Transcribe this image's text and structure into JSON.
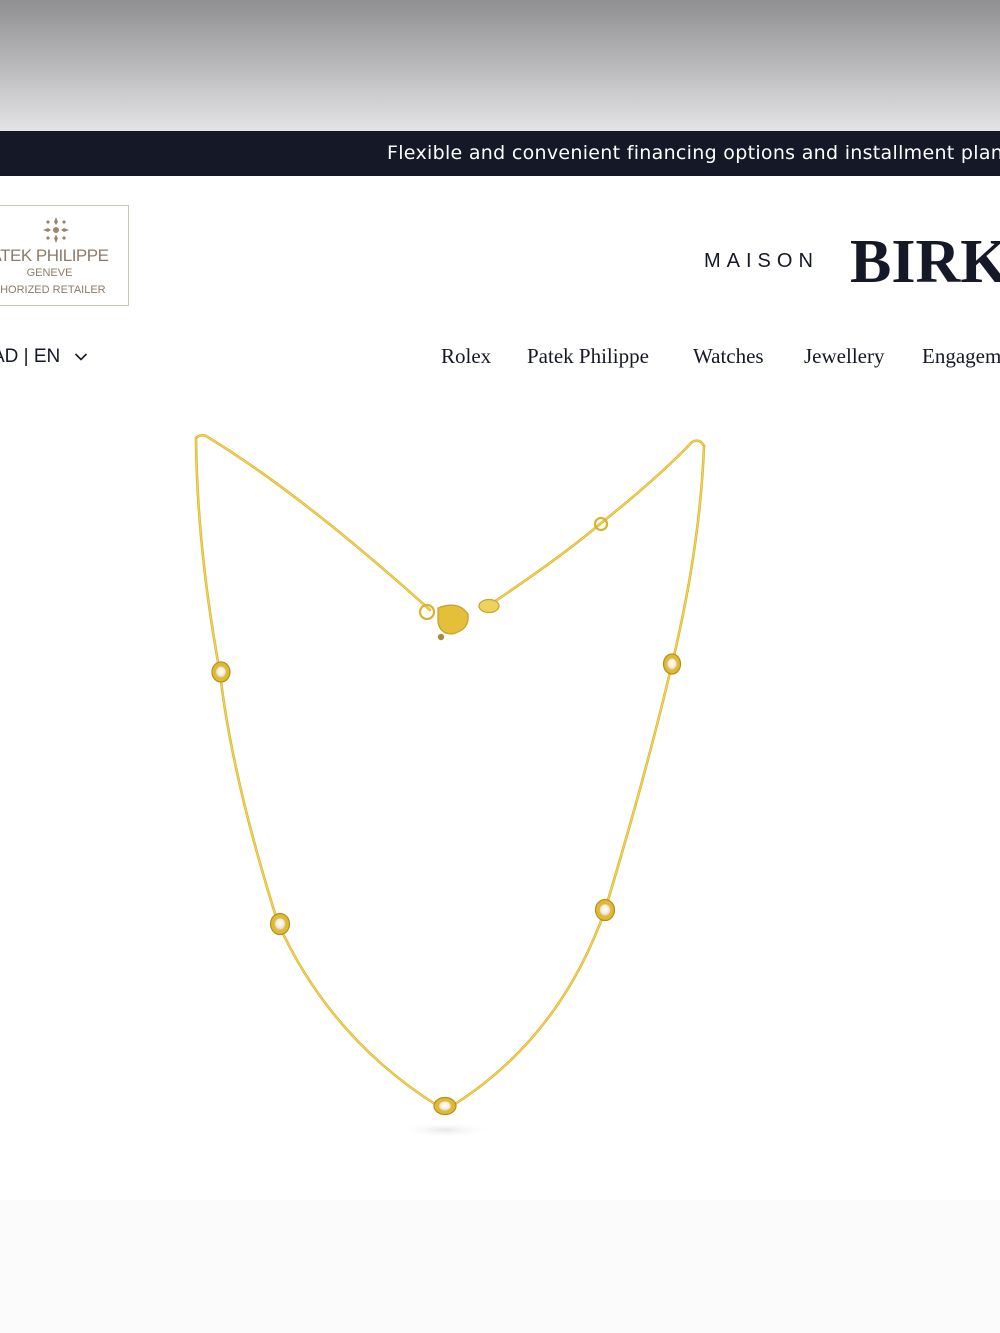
{
  "promo": {
    "text": "Flexible and convenient financing options and installment plan"
  },
  "header": {
    "retailer_badge": {
      "line1": "ATEK PHILIPPE",
      "line2": "GENEVE",
      "line3": "THORIZED RETAILER"
    },
    "brand": {
      "maison": "MAISON",
      "name": "BIRK"
    },
    "locale": "AD | EN",
    "nav": [
      "Rolex",
      "Patek Philippe",
      "Watches",
      "Jewellery",
      "Engagem"
    ]
  },
  "product": {
    "image": "gold-station-necklace",
    "metal_color": "#e8c545",
    "stone_count": 5
  },
  "colors": {
    "promo_bg": "#151826",
    "text": "#151826",
    "badge_text": "#8d7b67"
  }
}
